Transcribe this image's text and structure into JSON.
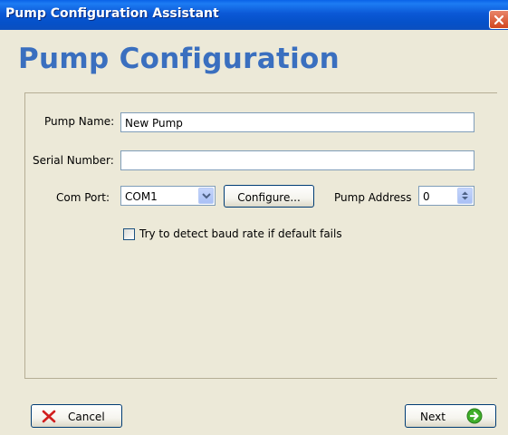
{
  "window": {
    "title": "Pump Configuration Assistant"
  },
  "page": {
    "heading": "Pump Configuration"
  },
  "form": {
    "pump_name_label": "Pump Name:",
    "pump_name_value": "New Pump",
    "serial_number_label": "Serial Number:",
    "serial_number_value": "",
    "com_port_label": "Com Port:",
    "com_port_value": "COM1",
    "configure_label": "Configure...",
    "pump_address_label": "Pump Address",
    "pump_address_value": "0",
    "detect_baud_label": "Try to detect baud rate if default fails",
    "detect_baud_checked": false
  },
  "footer": {
    "cancel_label": "Cancel",
    "next_label": "Next"
  },
  "icons": {
    "close": "close-icon",
    "combo_arrow": "chevron-down-icon",
    "spinner": "up-down-arrows-icon",
    "cancel": "red-x-icon",
    "next": "green-arrow-right-icon"
  },
  "colors": {
    "titlebar": "#0b58d6",
    "heading": "#3a6fbf",
    "window_bg": "#ece9d8",
    "close_button": "#d2461f",
    "next_icon": "#3fae2a",
    "cancel_icon": "#d11e1e"
  }
}
